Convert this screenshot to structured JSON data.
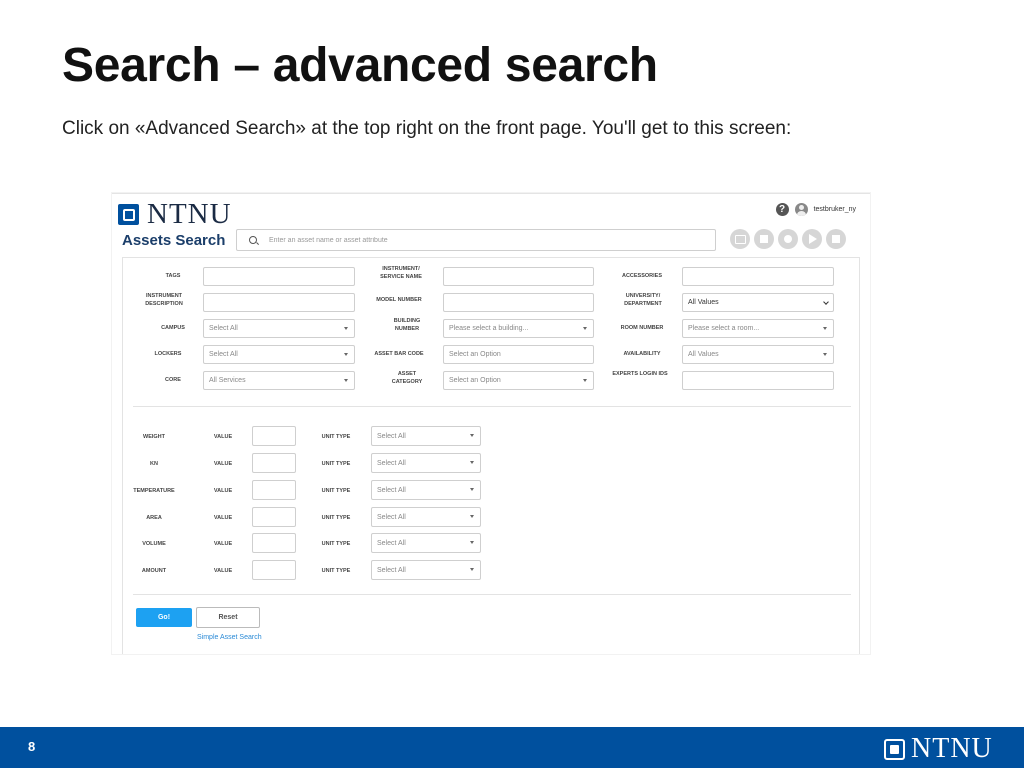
{
  "slide": {
    "title": "Search – advanced search",
    "subtitle": "Click on «Advanced Search» at the top right on the front page. You'll get to this screen:",
    "page_number": "8",
    "footer_logo": "NTNU"
  },
  "app": {
    "logo_text": "NTNU",
    "username": "testbruker_ny",
    "title": "Assets Search",
    "search_placeholder": "Enter an asset name or asset attribute",
    "action_icons": [
      "share-icon",
      "stop-icon",
      "clock-icon",
      "play-icon",
      "square-icon"
    ]
  },
  "form": {
    "rows": [
      {
        "l1": "TAGS",
        "v1": "",
        "l2": "INSTRUMENT/ SERVICE NAME",
        "v2": "",
        "l3": "ACCESSORIES",
        "v3": ""
      },
      {
        "l1": "INSTRUMENT DESCRIPTION",
        "v1": "",
        "l2": "MODEL NUMBER",
        "v2": "",
        "l3": "UNIVERSITY/ DEPARTMENT",
        "v3": "All Values"
      },
      {
        "l1": "CAMPUS",
        "v1": "Select All",
        "l2": "BUILDING NUMBER",
        "v2": "Please select a building...",
        "l3": "ROOM NUMBER",
        "v3": "Please select a room..."
      },
      {
        "l1": "LOCKERS",
        "v1": "Select All",
        "l2": "ASSET BAR CODE",
        "v2": "Select an Option",
        "l3": "AVAILABILITY",
        "v3": "All Values"
      },
      {
        "l1": "CORE",
        "v1": "All Services",
        "l2": "ASSET CATEGORY",
        "v2": "Select an Option",
        "l3": "EXPERTS LOGIN IDS",
        "v3": ""
      }
    ],
    "measures": [
      {
        "label": "WEIGHT",
        "value_label": "VALUE",
        "unit_label": "UNIT TYPE",
        "unit_value": "Select All"
      },
      {
        "label": "KN",
        "value_label": "VALUE",
        "unit_label": "UNIT TYPE",
        "unit_value": "Select All"
      },
      {
        "label": "TEMPERATURE",
        "value_label": "VALUE",
        "unit_label": "UNIT TYPE",
        "unit_value": "Select All"
      },
      {
        "label": "AREA",
        "value_label": "VALUE",
        "unit_label": "UNIT TYPE",
        "unit_value": "Select All"
      },
      {
        "label": "VOLUME",
        "value_label": "VALUE",
        "unit_label": "UNIT TYPE",
        "unit_value": "Select All"
      },
      {
        "label": "AMOUNT",
        "value_label": "VALUE",
        "unit_label": "UNIT TYPE",
        "unit_value": "Select All"
      }
    ],
    "go_label": "Go!",
    "reset_label": "Reset",
    "simple_search_link": "Simple Asset Search"
  }
}
